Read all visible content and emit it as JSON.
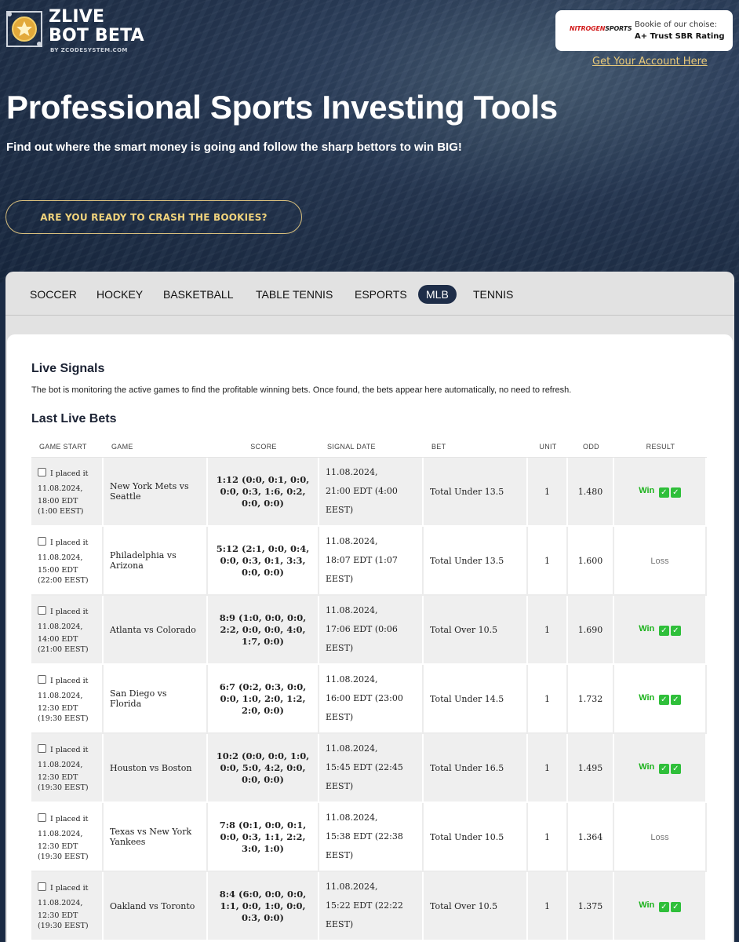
{
  "logo": {
    "line1": "ZLIVE",
    "line2": "BOT BETA",
    "sub": "BY ZCODESYSTEM.COM"
  },
  "bookie": {
    "brand_a": "NITROGEN",
    "brand_b": "SPORTS",
    "line1": "Bookie of our choise:",
    "line2": "A+ Trust SBR Rating",
    "link": "Get Your Account Here"
  },
  "hero": {
    "title": "Professional Sports Investing Tools",
    "subtitle": "Find out where the smart money is going and follow the sharp bettors to win BIG!",
    "cta": "ARE YOU READY TO CRASH THE BOOKIES?"
  },
  "tabs": [
    "SOCCER",
    "HOCKEY",
    "BASKETBALL",
    "TABLE TENNIS",
    "ESPORTS",
    "MLB",
    "TENNIS"
  ],
  "active_tab": "MLB",
  "signals": {
    "heading": "Live Signals",
    "description": "The bot is monitoring the active games to find the profitable winning bets. Once found, the bets appear here automatically, no need to refresh.",
    "last_heading": "Last Live Bets"
  },
  "table": {
    "headers": [
      "GAME START",
      "GAME",
      "SCORE",
      "SIGNAL DATE",
      "BET",
      "UNIT",
      "ODD",
      "RESULT"
    ],
    "placed_label": "I placed it",
    "check_glyph": "✓",
    "rows": [
      {
        "date": "11.08.2024,",
        "time": "18:00 EDT (1:00 EEST)",
        "game": "New York Mets vs Seattle",
        "score": "1:12 (0:0, 0:1, 0:0, 0:0, 0:3, 1:6, 0:2, 0:0, 0:0)",
        "signal_date": "11.08.2024,",
        "signal_time": "21:00 EDT (4:00 EEST)",
        "bet": "Total Under 13.5",
        "unit": "1",
        "odd": "1.480",
        "result": "Win"
      },
      {
        "date": "11.08.2024,",
        "time": "15:00 EDT (22:00 EEST)",
        "game": "Philadelphia vs Arizona",
        "score": "5:12 (2:1, 0:0, 0:4, 0:0, 0:3, 0:1, 3:3, 0:0, 0:0)",
        "signal_date": "11.08.2024,",
        "signal_time": "18:07 EDT (1:07 EEST)",
        "bet": "Total Under 13.5",
        "unit": "1",
        "odd": "1.600",
        "result": "Loss"
      },
      {
        "date": "11.08.2024,",
        "time": "14:00 EDT (21:00 EEST)",
        "game": "Atlanta vs Colorado",
        "score": "8:9 (1:0, 0:0, 0:0, 2:2, 0:0, 0:0, 4:0, 1:7, 0:0)",
        "signal_date": "11.08.2024,",
        "signal_time": "17:06 EDT (0:06 EEST)",
        "bet": "Total Over 10.5",
        "unit": "1",
        "odd": "1.690",
        "result": "Win"
      },
      {
        "date": "11.08.2024,",
        "time": "12:30 EDT (19:30 EEST)",
        "game": "San Diego vs Florida",
        "score": "6:7 (0:2, 0:3, 0:0, 0:0, 1:0, 2:0, 1:2, 2:0, 0:0)",
        "signal_date": "11.08.2024,",
        "signal_time": "16:00 EDT (23:00 EEST)",
        "bet": "Total Under 14.5",
        "unit": "1",
        "odd": "1.732",
        "result": "Win"
      },
      {
        "date": "11.08.2024,",
        "time": "12:30 EDT (19:30 EEST)",
        "game": "Houston vs Boston",
        "score": "10:2 (0:0, 0:0, 1:0, 0:0, 5:0, 4:2, 0:0, 0:0, 0:0)",
        "signal_date": "11.08.2024,",
        "signal_time": "15:45 EDT (22:45 EEST)",
        "bet": "Total Under 16.5",
        "unit": "1",
        "odd": "1.495",
        "result": "Win"
      },
      {
        "date": "11.08.2024,",
        "time": "12:30 EDT (19:30 EEST)",
        "game": "Texas vs New York Yankees",
        "score": "7:8 (0:1, 0:0, 0:1, 0:0, 0:3, 1:1, 2:2, 3:0, 1:0)",
        "signal_date": "11.08.2024,",
        "signal_time": "15:38 EDT (22:38 EEST)",
        "bet": "Total Under 10.5",
        "unit": "1",
        "odd": "1.364",
        "result": "Loss"
      },
      {
        "date": "11.08.2024,",
        "time": "12:30 EDT (19:30 EEST)",
        "game": "Oakland vs Toronto",
        "score": "8:4 (6:0, 0:0, 0:0, 1:1, 0:0, 1:0, 0:0, 0:3, 0:0)",
        "signal_date": "11.08.2024,",
        "signal_time": "15:22 EDT (22:22 EEST)",
        "bet": "Total Over 10.5",
        "unit": "1",
        "odd": "1.375",
        "result": "Win"
      }
    ]
  },
  "colors": {
    "navy": "#1e2d48",
    "gold": "#f0d37c",
    "win": "#1bb21b",
    "loss": "#777777"
  }
}
